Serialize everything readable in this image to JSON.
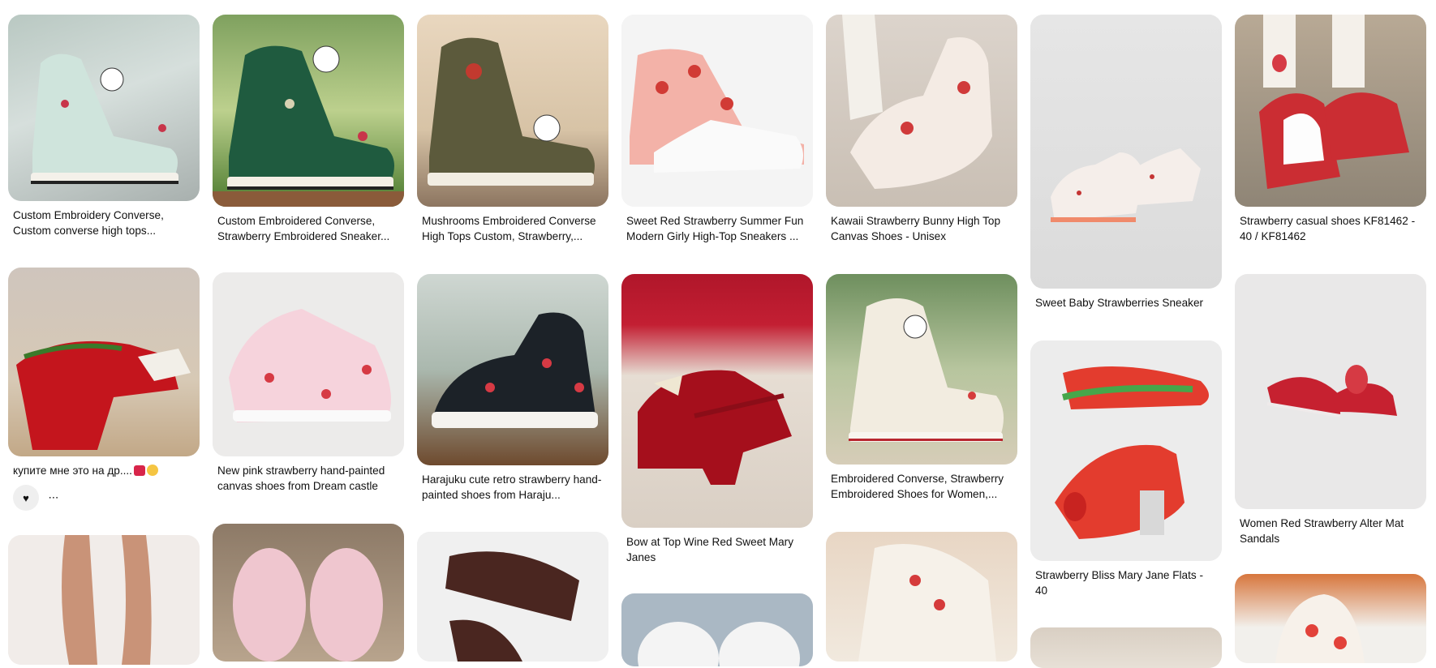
{
  "pins": [
    {
      "caption": "Custom Embroidery Converse, Custom converse high tops..."
    },
    {
      "caption": "Custom Embroidered Converse, Strawberry Embroidered Sneaker..."
    },
    {
      "caption": "Mushrooms Embroidered Converse High Tops Custom, Strawberry,..."
    },
    {
      "caption": "Sweet Red Strawberry Summer Fun Modern Girly High-Top Sneakers ..."
    },
    {
      "caption": "Kawaii Strawberry Bunny High Top Canvas Shoes - Unisex"
    },
    {
      "caption": "Sweet Baby Strawberries Sneaker"
    },
    {
      "caption": "Strawberry casual shoes KF81462 - 40 / KF81462"
    },
    {
      "caption": "купите мне это на др...."
    },
    {
      "caption": "New pink strawberry hand-painted canvas shoes from Dream castle"
    },
    {
      "caption": "Harajuku cute retro strawberry hand-painted shoes from Haraju..."
    },
    {
      "caption": "Bow at Top Wine Red Sweet Mary Janes"
    },
    {
      "caption": "Embroidered Converse, Strawberry Embroidered Shoes for Women,..."
    },
    {
      "caption": "Strawberry Bliss Mary Jane Flats - 40"
    },
    {
      "caption": "Women Red Strawberry Alter Mat Sandals"
    }
  ],
  "reactions": {
    "react_icon": "heart-reaction-icon",
    "more_icon": "more-icon"
  }
}
